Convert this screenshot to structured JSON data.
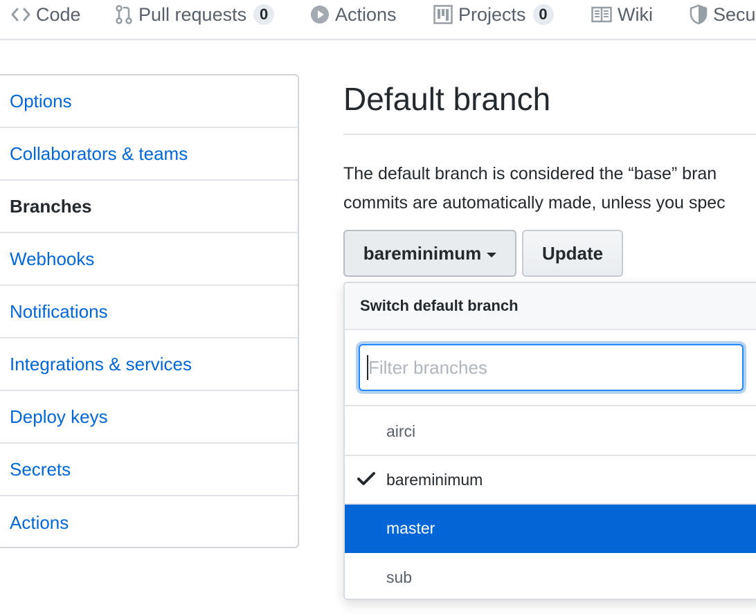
{
  "repo_nav": {
    "items": [
      {
        "label": "Code",
        "icon": "code-icon"
      },
      {
        "label": "Pull requests",
        "icon": "pull-request-icon",
        "count": "0"
      },
      {
        "label": "Actions",
        "icon": "play-icon"
      },
      {
        "label": "Projects",
        "icon": "project-icon",
        "count": "0"
      },
      {
        "label": "Wiki",
        "icon": "book-icon"
      },
      {
        "label": "Secu",
        "icon": "shield-icon"
      }
    ]
  },
  "settings_menu": {
    "items": [
      {
        "label": "Options"
      },
      {
        "label": "Collaborators & teams"
      },
      {
        "label": "Branches",
        "selected": true
      },
      {
        "label": "Webhooks"
      },
      {
        "label": "Notifications"
      },
      {
        "label": "Integrations & services"
      },
      {
        "label": "Deploy keys"
      },
      {
        "label": "Secrets"
      },
      {
        "label": "Actions"
      }
    ]
  },
  "main": {
    "title": "Default branch",
    "description_line1": "The default branch is considered the “base” bran",
    "description_line2": "commits are automatically made, unless you spec",
    "branch_button_label": "bareminimum",
    "update_button_label": "Update"
  },
  "dropdown": {
    "header": "Switch default branch",
    "filter_placeholder": "Filter branches",
    "branches": [
      {
        "name": "airci"
      },
      {
        "name": "bareminimum",
        "checked": true
      },
      {
        "name": "master",
        "active": true
      },
      {
        "name": "sub"
      }
    ]
  },
  "colors": {
    "link": "#0366d6",
    "text": "#24292e",
    "muted": "#586069",
    "selected_row": "#0366d6",
    "border": "#e1e4e8"
  }
}
